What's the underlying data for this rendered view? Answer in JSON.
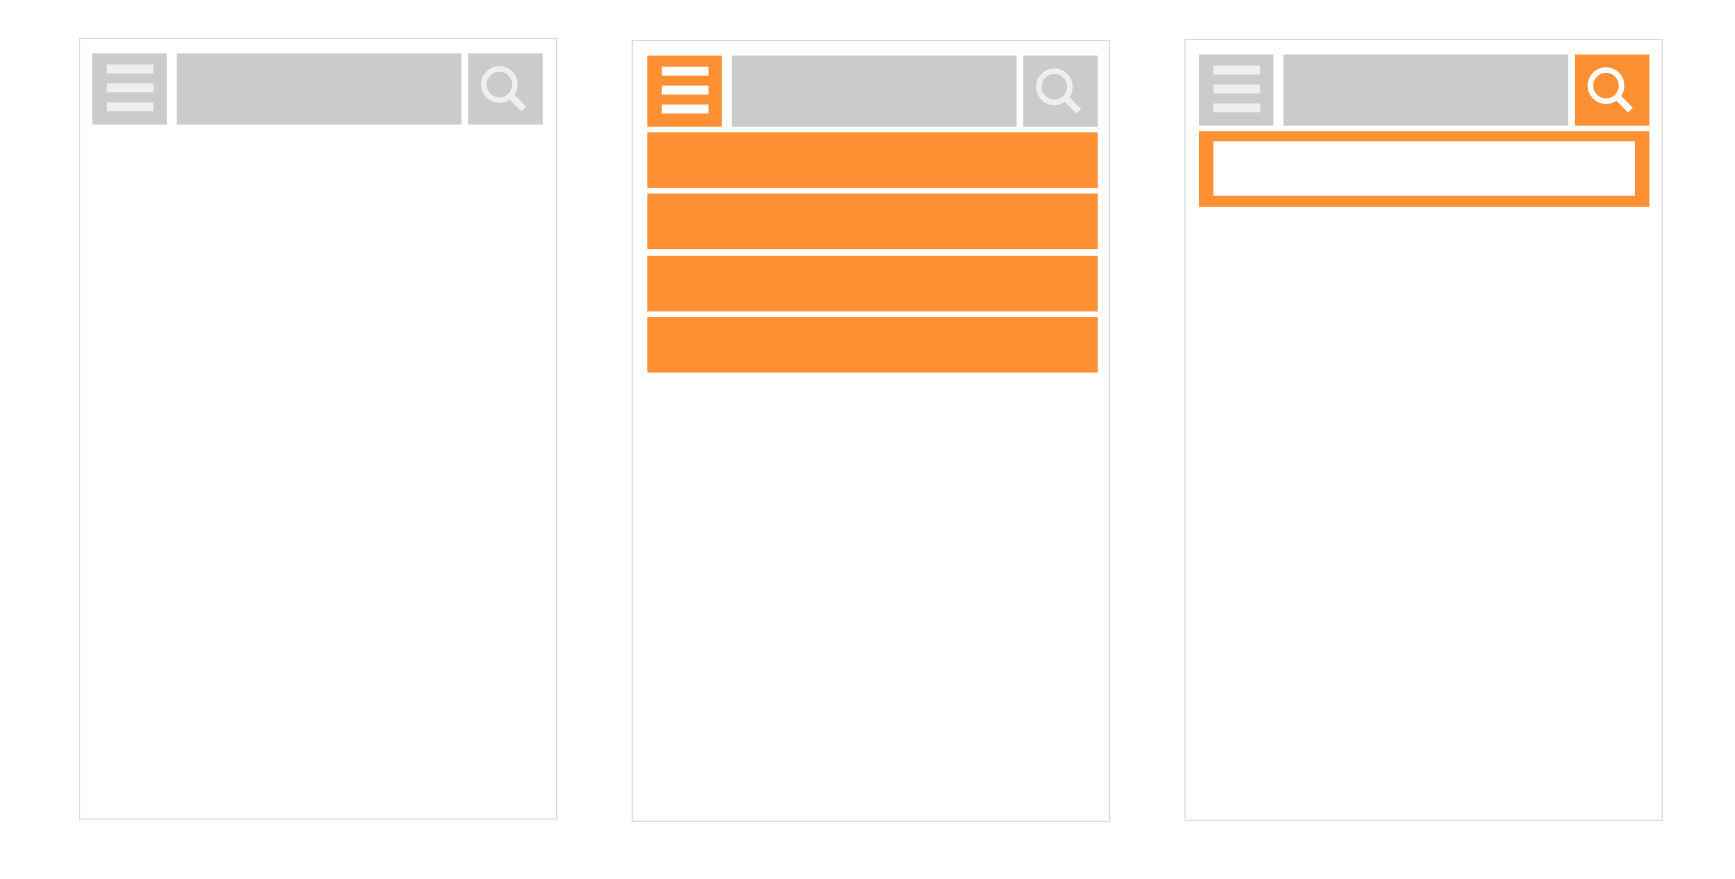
{
  "colors": {
    "accent": "#fd9033",
    "gray": "#cbcbcb",
    "icon": "#efefef",
    "border": "#d9d9d9"
  },
  "panels": [
    {
      "state": "default",
      "icons": [
        "menu-icon",
        "search-icon"
      ]
    },
    {
      "state": "menu-open",
      "icons": [
        "menu-icon",
        "search-icon"
      ],
      "menu_item_count": 4
    },
    {
      "state": "search-open",
      "icons": [
        "menu-icon",
        "search-icon"
      ]
    }
  ]
}
